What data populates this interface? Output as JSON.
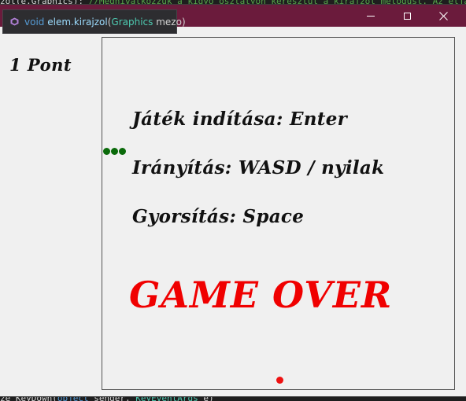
{
  "editor": {
    "top_code": "zol(e.Graphics);",
    "top_comment": " //Meghívatkozzuk a kígyó osztályon keresztül a kirajzol metódust. Az eljárás bemenete",
    "bottom_code_plain1": "ze_KeyDown(",
    "bottom_code_kw": "object",
    "bottom_code_plain2": " sender, ",
    "bottom_code_type": "KeyEventArgs",
    "bottom_code_plain3": " e)"
  },
  "tooltip": {
    "icon": "method-icon",
    "return_type": "void",
    "method": "elem.kirajzol",
    "open_paren": "(",
    "param_type": "Graphics",
    "param_name": "mezo",
    "close_paren": ")"
  },
  "window": {
    "title": "",
    "titlebar_color": "#6b1b3c",
    "controls": [
      "minimize-icon",
      "maximize-icon",
      "close-icon"
    ]
  },
  "game": {
    "score": "1 Pont",
    "start_hint": "Játék indítása: Enter",
    "controls_hint": "Irányítás: WASD / nyilak",
    "speed_hint": "Gyorsítás: Space",
    "game_over": "GAME OVER",
    "snake_color": "#0a6a0a",
    "food_color": "#ee1111",
    "game_over_color": "#f00000"
  }
}
